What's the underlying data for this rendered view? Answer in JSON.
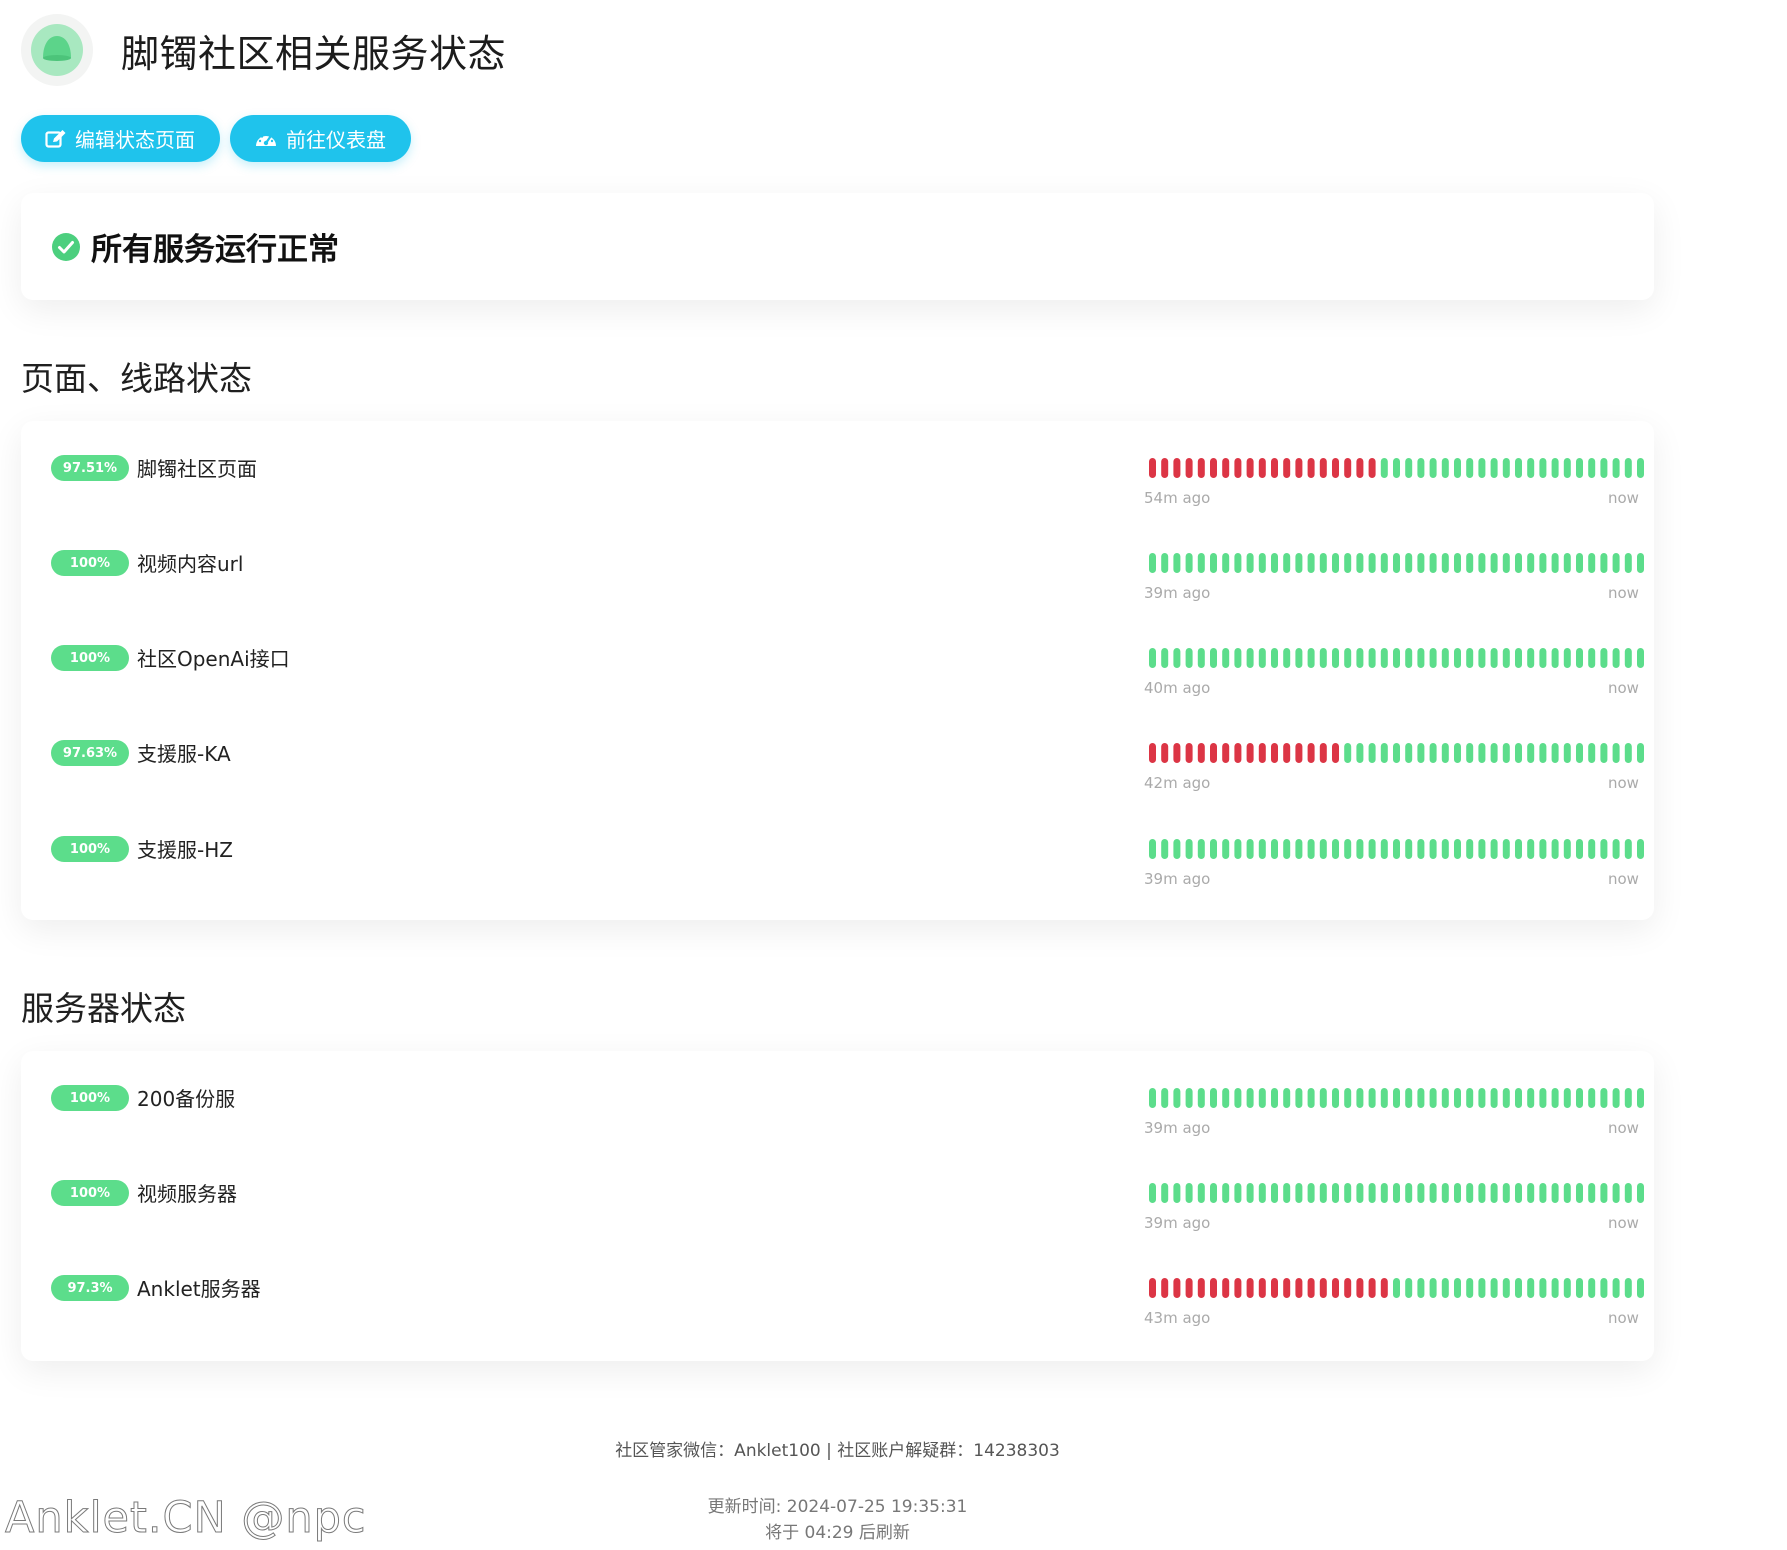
{
  "header": {
    "title": "脚镯社区相关服务状态"
  },
  "actions": {
    "edit_label": "编辑状态页面",
    "dashboard_label": "前往仪表盘"
  },
  "overall": {
    "text": "所有服务运行正常"
  },
  "colors": {
    "up": "#5cdd8b",
    "down": "#dc3545",
    "accent": "#1fc3ec"
  },
  "groups": [
    {
      "title": "页面、线路状态",
      "monitors": [
        {
          "uptime": "97.51%",
          "name": "脚镯社区页面",
          "down_beats": 19,
          "total_beats": 41,
          "start_label": "54m ago",
          "end_label": "now"
        },
        {
          "uptime": "100%",
          "name": "视频内容url",
          "down_beats": 0,
          "total_beats": 41,
          "start_label": "39m ago",
          "end_label": "now"
        },
        {
          "uptime": "100%",
          "name": "社区OpenAi接口",
          "down_beats": 0,
          "total_beats": 41,
          "start_label": "40m ago",
          "end_label": "now"
        },
        {
          "uptime": "97.63%",
          "name": "支援服-KA",
          "down_beats": 16,
          "total_beats": 41,
          "start_label": "42m ago",
          "end_label": "now"
        },
        {
          "uptime": "100%",
          "name": "支援服-HZ",
          "down_beats": 0,
          "total_beats": 41,
          "start_label": "39m ago",
          "end_label": "now"
        }
      ]
    },
    {
      "title": "服务器状态",
      "monitors": [
        {
          "uptime": "100%",
          "name": "200备份服",
          "down_beats": 0,
          "total_beats": 41,
          "start_label": "39m ago",
          "end_label": "now"
        },
        {
          "uptime": "100%",
          "name": "视频服务器",
          "down_beats": 0,
          "total_beats": 41,
          "start_label": "39m ago",
          "end_label": "now"
        },
        {
          "uptime": "97.3%",
          "name": "Anklet服务器",
          "down_beats": 20,
          "total_beats": 41,
          "start_label": "43m ago",
          "end_label": "now"
        }
      ]
    }
  ],
  "footer": {
    "contact": "社区管家微信：Anklet100 | 社区账户解疑群：14238303",
    "updated": "更新时间: 2024-07-25 19:35:31",
    "refresh": "将于 04:29 后刷新"
  },
  "watermark": "Anklet.CN @npc"
}
